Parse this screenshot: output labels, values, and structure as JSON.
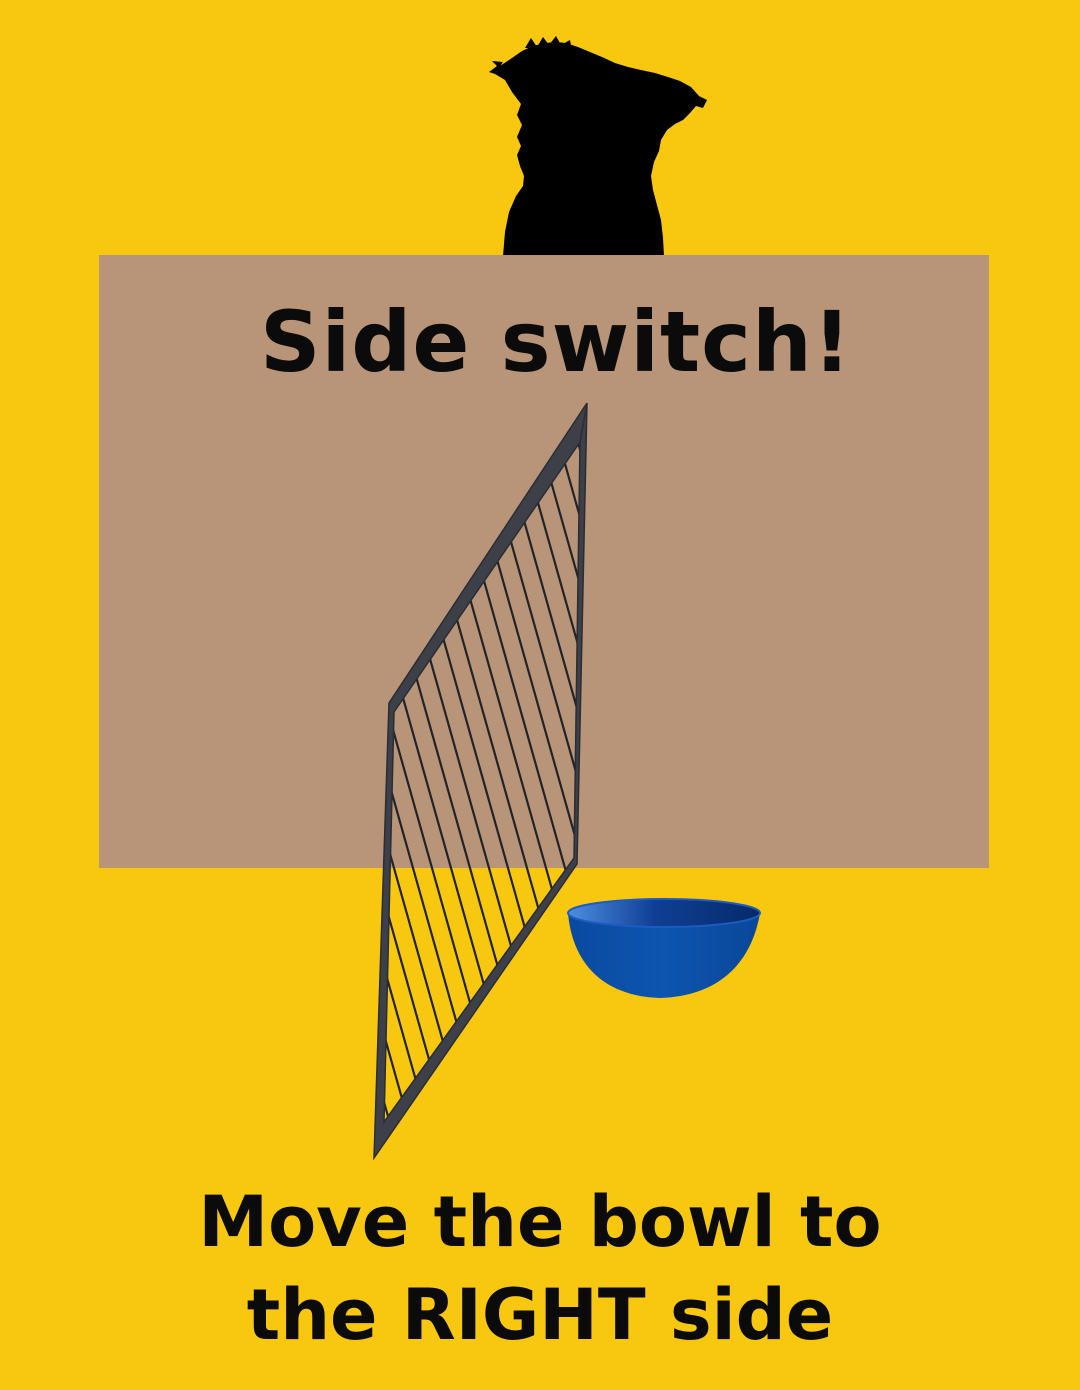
{
  "title": "Side switch!",
  "instruction": {
    "line1": "Move the bowl to",
    "line2": "the RIGHT side"
  },
  "colors": {
    "background": "#F8C810",
    "wall": "#B89478",
    "gate_frame": "#3d4048",
    "bowl": "#0A4FA8",
    "dog": "#000000"
  },
  "icons": {
    "dog": "dog-silhouette-icon",
    "gate": "mesh-gate-icon",
    "bowl": "bowl-icon"
  }
}
